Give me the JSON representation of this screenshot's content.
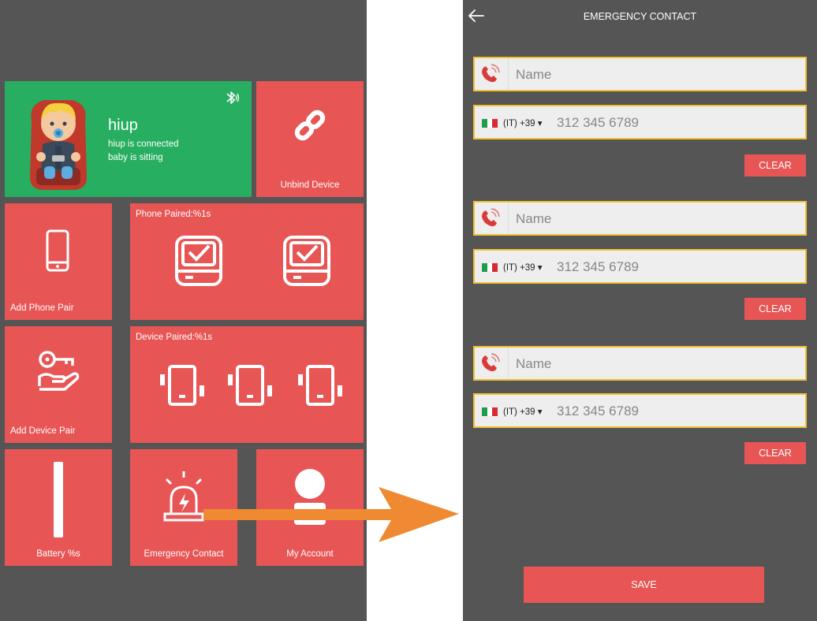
{
  "colors": {
    "tile_red": "#e85555",
    "tile_green": "#27ae60",
    "background": "#555555",
    "field_border": "#f1c232",
    "arrow": "#ef8a33"
  },
  "dashboard": {
    "status": {
      "icon": "bluetooth-icon",
      "name": "hiup",
      "line1": "hiup is connected",
      "line2": "baby is sitting"
    },
    "unbind": {
      "icon": "link-icon",
      "label": "Unbind Device"
    },
    "add_phone": {
      "icon": "smartphone-icon",
      "label": "Add Phone Pair"
    },
    "phone_paired": {
      "icon": "phone-check-icon",
      "label": "Phone Paired:%1s"
    },
    "add_device": {
      "icon": "key-hand-icon",
      "label": "Add Device Pair"
    },
    "device_paired": {
      "icon": "device-icon",
      "label": "Device Paired:%1s"
    },
    "battery": {
      "icon": "battery-bar-icon",
      "label": "Battery %s"
    },
    "emergency": {
      "icon": "alarm-light-icon",
      "label": "Emergency Contact"
    },
    "account": {
      "icon": "user-icon",
      "label": "My Account"
    }
  },
  "emergency_screen": {
    "title": "EMERGENCY CONTACT",
    "contacts": [
      {
        "name_placeholder": "Name",
        "country_code": "(IT) +39 ▾",
        "number_placeholder": "312 345 6789",
        "clear_label": "CLEAR"
      },
      {
        "name_placeholder": "Name",
        "country_code": "(IT) +39 ▾",
        "number_placeholder": "312 345 6789",
        "clear_label": "CLEAR"
      },
      {
        "name_placeholder": "Name",
        "country_code": "(IT) +39 ▾",
        "number_placeholder": "312 345 6789",
        "clear_label": "CLEAR"
      }
    ],
    "save_label": "SAVE"
  }
}
